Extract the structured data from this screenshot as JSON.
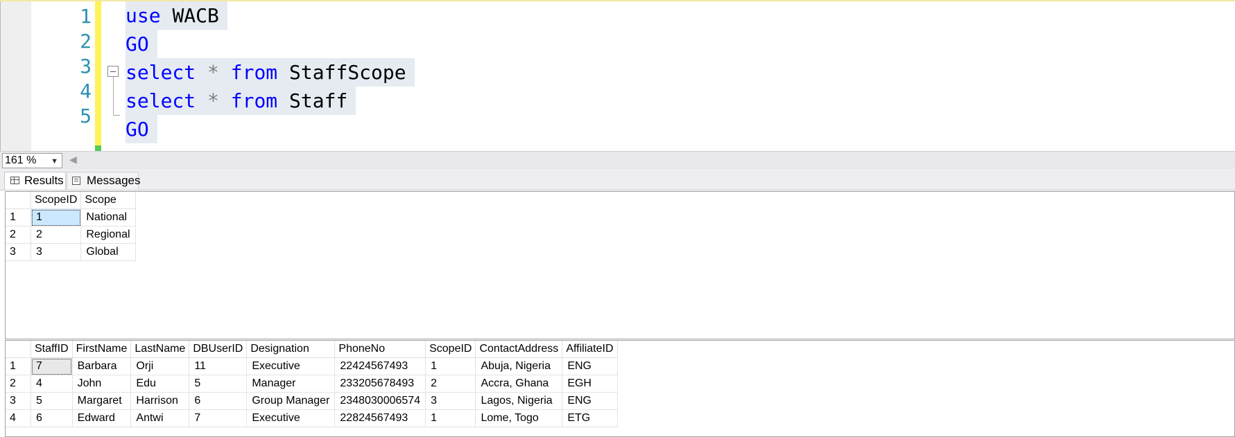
{
  "editor": {
    "line_numbers": [
      "1",
      "2",
      "3",
      "4",
      "5"
    ],
    "line1": {
      "kw": "use",
      "rest": "WACB"
    },
    "line2": {
      "kw": "GO"
    },
    "line3": {
      "kw1": "select",
      "op": "*",
      "kw2": "from",
      "ident": "StaffScope"
    },
    "line4": {
      "kw1": "select",
      "op": "*",
      "kw2": "from",
      "ident": "Staff"
    },
    "line5": {
      "kw": "GO"
    }
  },
  "zoom": {
    "value": "161 %"
  },
  "tabs": {
    "results": "Results",
    "messages": "Messages"
  },
  "grid1": {
    "columns": [
      "ScopeID",
      "Scope"
    ],
    "rows": [
      {
        "n": "1",
        "cells": [
          "1",
          "National"
        ]
      },
      {
        "n": "2",
        "cells": [
          "2",
          "Regional"
        ]
      },
      {
        "n": "3",
        "cells": [
          "3",
          "Global"
        ]
      }
    ]
  },
  "grid2": {
    "columns": [
      "StaffID",
      "FirstName",
      "LastName",
      "DBUserID",
      "Designation",
      "PhoneNo",
      "ScopeID",
      "ContactAddress",
      "AffiliateID"
    ],
    "rows": [
      {
        "n": "1",
        "cells": [
          "7",
          "Barbara",
          "Orji",
          "11",
          "Executive",
          "22424567493",
          "1",
          "Abuja, Nigeria",
          "ENG"
        ]
      },
      {
        "n": "2",
        "cells": [
          "4",
          "John",
          "Edu",
          "5",
          "Manager",
          "233205678493",
          "2",
          "Accra, Ghana",
          "EGH"
        ]
      },
      {
        "n": "3",
        "cells": [
          "5",
          "Margaret",
          "Harrison",
          "6",
          "Group Manager",
          "2348030006574",
          "3",
          "Lagos, Nigeria",
          "ENG"
        ]
      },
      {
        "n": "4",
        "cells": [
          "6",
          "Edward",
          "Antwi",
          "7",
          "Executive",
          "22824567493",
          "1",
          "Lome, Togo",
          "ETG"
        ]
      }
    ]
  }
}
